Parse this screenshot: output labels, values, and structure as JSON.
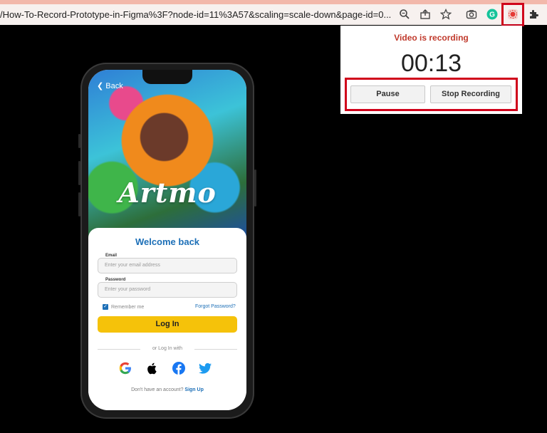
{
  "browser": {
    "url": "/How-To-Record-Prototype-in-Figma%3F?node-id=11%3A57&scaling=scale-down&page-id=0...",
    "icons": [
      "zoom-icon",
      "share-icon",
      "star-icon",
      "camera-icon",
      "grammarly-icon",
      "screen-recorder-icon",
      "puzzle-icon"
    ]
  },
  "recorder": {
    "status": "Video is recording",
    "timer": "00:13",
    "pause_label": "Pause",
    "stop_label": "Stop Recording"
  },
  "app": {
    "back_label": "Back",
    "logo": "Artmo",
    "welcome": "Welcome back",
    "email_label": "Email",
    "email_placeholder": "Enter your email address",
    "password_label": "Password",
    "password_placeholder": "Enter your password",
    "remember_label": "Remember me",
    "forgot_label": "Forgot Password?",
    "login_label": "Log In",
    "or_with": "or Log In with",
    "no_account": "Don't have an account?",
    "signup_label": "Sign Up",
    "social": [
      "google-icon",
      "apple-icon",
      "facebook-icon",
      "twitter-icon"
    ]
  },
  "colors": {
    "highlight": "#d0021b",
    "recording_text": "#c0392b",
    "primary_blue": "#1c6fb7",
    "login_yellow": "#f5c20a"
  }
}
